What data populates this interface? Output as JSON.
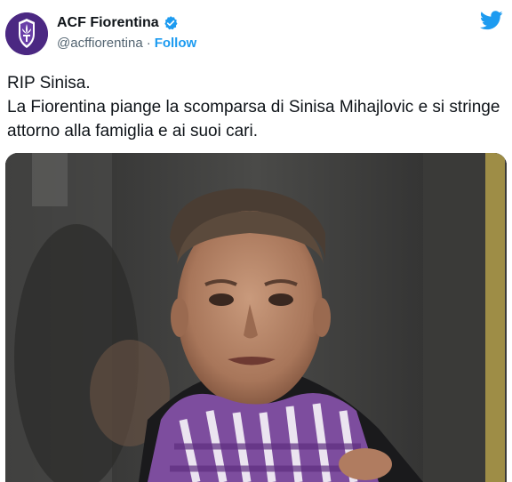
{
  "account": {
    "name": "ACF Fiorentina",
    "handle": "@acffiorentina",
    "separator": "·",
    "follow_label": "Follow",
    "verified": true,
    "avatar_icon": "fiorentina-lily-crest-icon",
    "platform_icon": "twitter-bird-icon"
  },
  "tweet": {
    "line1": "RIP Sinisa.",
    "line2": "La Fiorentina piange la scomparsa di Sinisa Mihajlovic e si stringe attorno alla famiglia e ai suoi cari."
  },
  "colors": {
    "accent": "#1d9bf0",
    "brand_purple": "#4b2882",
    "text": "#0f1419",
    "secondary_text": "#536471"
  }
}
